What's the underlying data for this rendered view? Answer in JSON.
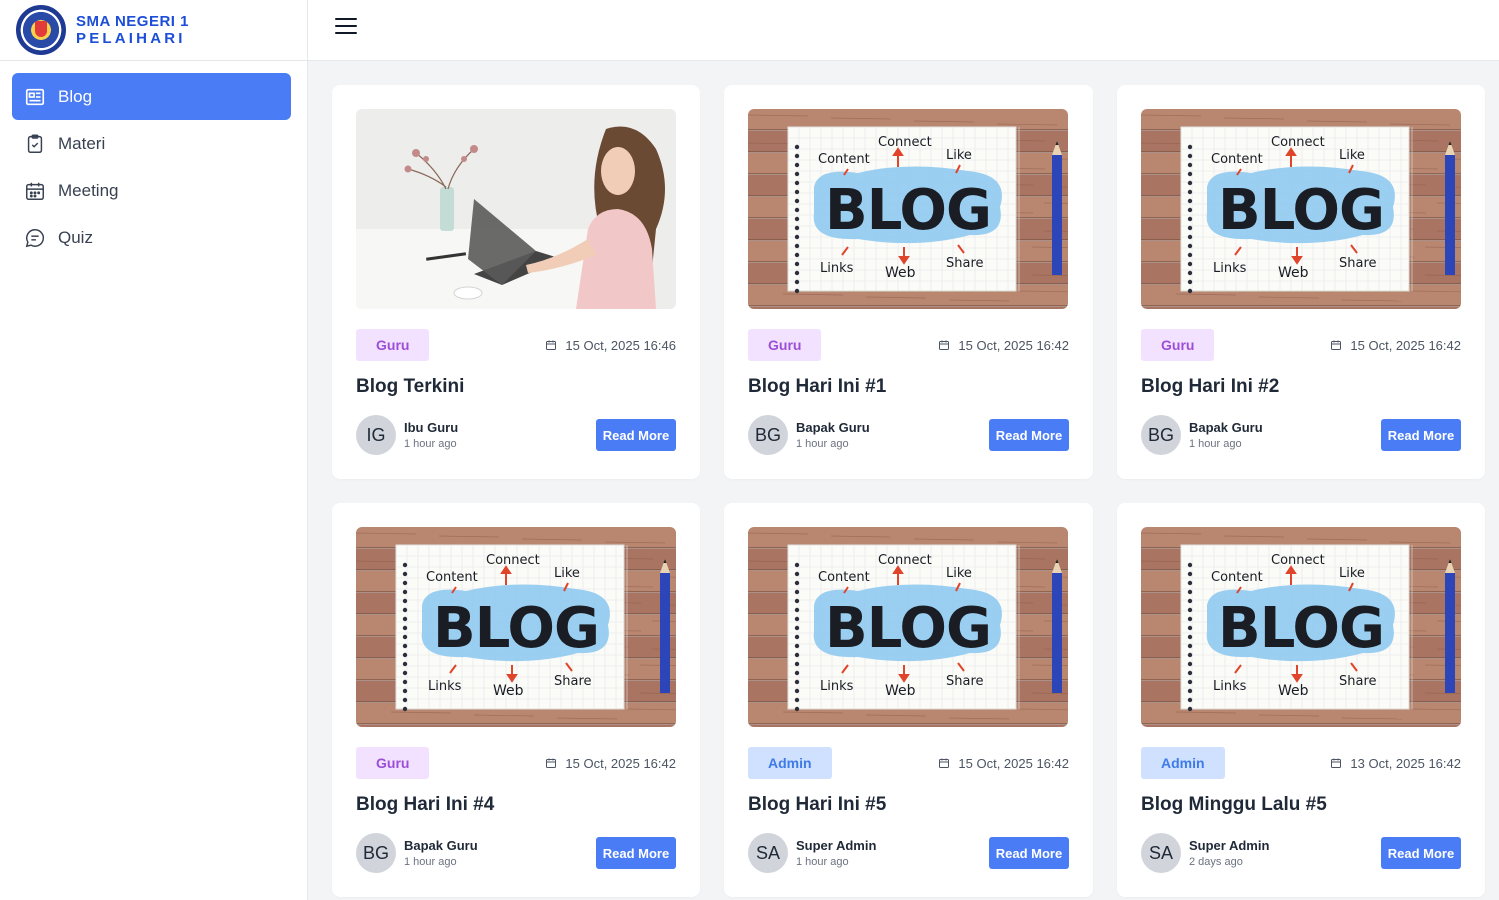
{
  "brand": {
    "line1": "SMA NEGERI 1",
    "line2": "PELAIHARI"
  },
  "sidebar": {
    "items": [
      {
        "label": "Blog",
        "icon": "newspaper-icon",
        "active": true
      },
      {
        "label": "Materi",
        "icon": "clipboard-check-icon",
        "active": false
      },
      {
        "label": "Meeting",
        "icon": "calendar-icon",
        "active": false
      },
      {
        "label": "Quiz",
        "icon": "chat-bubble-icon",
        "active": false
      }
    ]
  },
  "colors": {
    "accent": "#4a7cf6",
    "guru_badge_bg": "#f3e2ff",
    "guru_badge_text": "#9b4fd6",
    "admin_badge_bg": "#cfe1ff",
    "admin_badge_text": "#3f7be8"
  },
  "posts": [
    {
      "image": "woman-laptop-photo",
      "badge": "Guru",
      "date": "15 Oct, 2025 16:46",
      "title": "Blog Terkini",
      "initials": "IG",
      "author": "Ibu Guru",
      "time": "1 hour ago",
      "button": "Read More"
    },
    {
      "image": "blog-notebook-illustration",
      "badge": "Guru",
      "date": "15 Oct, 2025 16:42",
      "title": "Blog Hari Ini #1",
      "initials": "BG",
      "author": "Bapak Guru",
      "time": "1 hour ago",
      "button": "Read More"
    },
    {
      "image": "blog-notebook-illustration",
      "badge": "Guru",
      "date": "15 Oct, 2025 16:42",
      "title": "Blog Hari Ini #2",
      "initials": "BG",
      "author": "Bapak Guru",
      "time": "1 hour ago",
      "button": "Read More"
    },
    {
      "image": "blog-notebook-illustration",
      "badge": "Guru",
      "date": "15 Oct, 2025 16:42",
      "title": "Blog Hari Ini #4",
      "initials": "BG",
      "author": "Bapak Guru",
      "time": "1 hour ago",
      "button": "Read More"
    },
    {
      "image": "blog-notebook-illustration",
      "badge": "Admin",
      "date": "15 Oct, 2025 16:42",
      "title": "Blog Hari Ini #5",
      "initials": "SA",
      "author": "Super Admin",
      "time": "1 hour ago",
      "button": "Read More"
    },
    {
      "image": "blog-notebook-illustration",
      "badge": "Admin",
      "date": "13 Oct, 2025 16:42",
      "title": "Blog Minggu Lalu #5",
      "initials": "SA",
      "author": "Super Admin",
      "time": "2 days ago",
      "button": "Read More"
    }
  ],
  "illustration_words": {
    "center": "BLOG",
    "words": [
      "Content",
      "Connect",
      "Like",
      "Links",
      "Web",
      "Share"
    ]
  }
}
